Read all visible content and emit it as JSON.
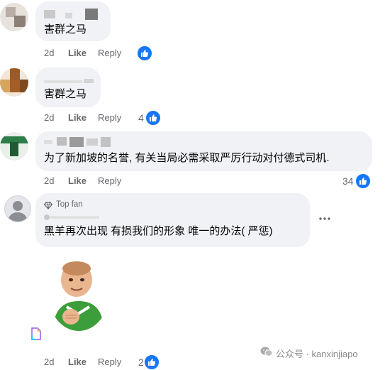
{
  "comments": [
    {
      "text": "害群之马",
      "time": "2d",
      "like": "Like",
      "reply": "Reply",
      "reactions": ""
    },
    {
      "text": "害群之马",
      "time": "2d",
      "like": "Like",
      "reply": "Reply",
      "reactions": "4"
    },
    {
      "text": "为了新加坡的名誉, 有关当局必需采取严厉行动对付德式司机.",
      "time": "2d",
      "like": "Like",
      "reply": "Reply",
      "reactions": "34"
    },
    {
      "badge": "Top fan",
      "text": "黑羊再次出现 有损我们的形象 唯一的办法( 严惩)",
      "time": "2d",
      "like": "Like",
      "reply": "Reply",
      "reactions": "2"
    }
  ],
  "watermark": "公众号 · kanxinjiapo",
  "colors": {
    "accent": "#1877f2",
    "bubble": "#f0f2f5",
    "meta": "#65676b"
  }
}
